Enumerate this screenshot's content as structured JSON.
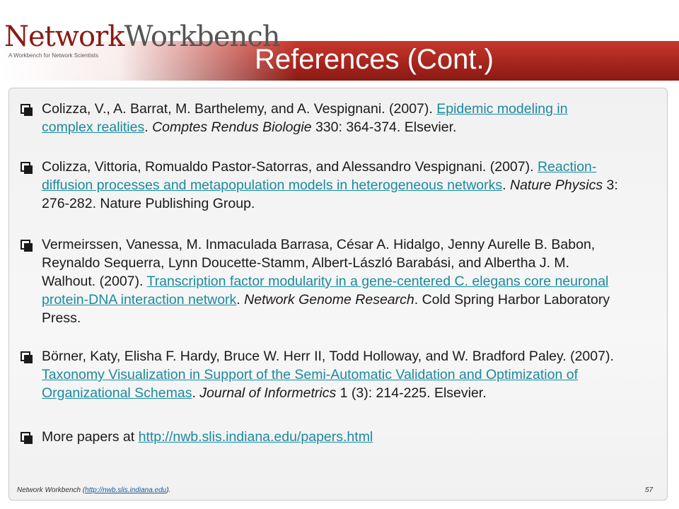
{
  "header": {
    "logo_net": "Network",
    "logo_wb": "Workbench",
    "logo_tagline": "A Workbench for Network Scientists",
    "title": "References (Cont.)"
  },
  "references": [
    {
      "pre": "Colizza, V., A. Barrat, M. Barthelemy, and A. Vespignani. (2007). ",
      "link": "Epidemic modeling in complex realities",
      "post": ". ",
      "journal": "Comptes Rendus Biologie",
      "tail": " 330: 364-374. Elsevier."
    },
    {
      "pre": "Colizza, Vittoria, Romualdo Pastor-Satorras, and Alessandro Vespignani. (2007). ",
      "link": "Reaction-diffusion processes and metapopulation models in heterogeneous networks",
      "post": ". ",
      "journal": "Nature Physics",
      "tail": " 3: 276-282. Nature Publishing Group."
    },
    {
      "pre": "Vermeirssen, Vanessa, M. Inmaculada Barrasa, César A. Hidalgo, Jenny Aurelle B. Babon, Reynaldo Sequerra, Lynn Doucette-Stamm, Albert-László Barabási, and Albertha J. M. Walhout. (2007). ",
      "link": "Transcription factor modularity in a gene-centered C. elegans core neuronal protein-DNA interaction network",
      "post": ". ",
      "journal": "Network Genome Research",
      "tail": ". Cold Spring Harbor Laboratory Press."
    },
    {
      "pre": "Börner, Katy, Elisha F. Hardy, Bruce W. Herr II, Todd Holloway, and W. Bradford Paley. (2007). ",
      "link": "Taxonomy Visualization in Support of the Semi-Automatic Validation and Optimization of Organizational Schemas",
      "post": ". ",
      "journal": "Journal of Informetrics",
      "tail": " 1 (3): 214-225. Elsevier."
    },
    {
      "pre": "More papers at ",
      "link": "http://nwb.slis.indiana.edu/papers.html",
      "post": "",
      "journal": "",
      "tail": ""
    }
  ],
  "footer": {
    "prefix": "Network Workbench (",
    "link": "http://nwb.slis.indiana.edu",
    "suffix": ").",
    "page_number": "57"
  }
}
